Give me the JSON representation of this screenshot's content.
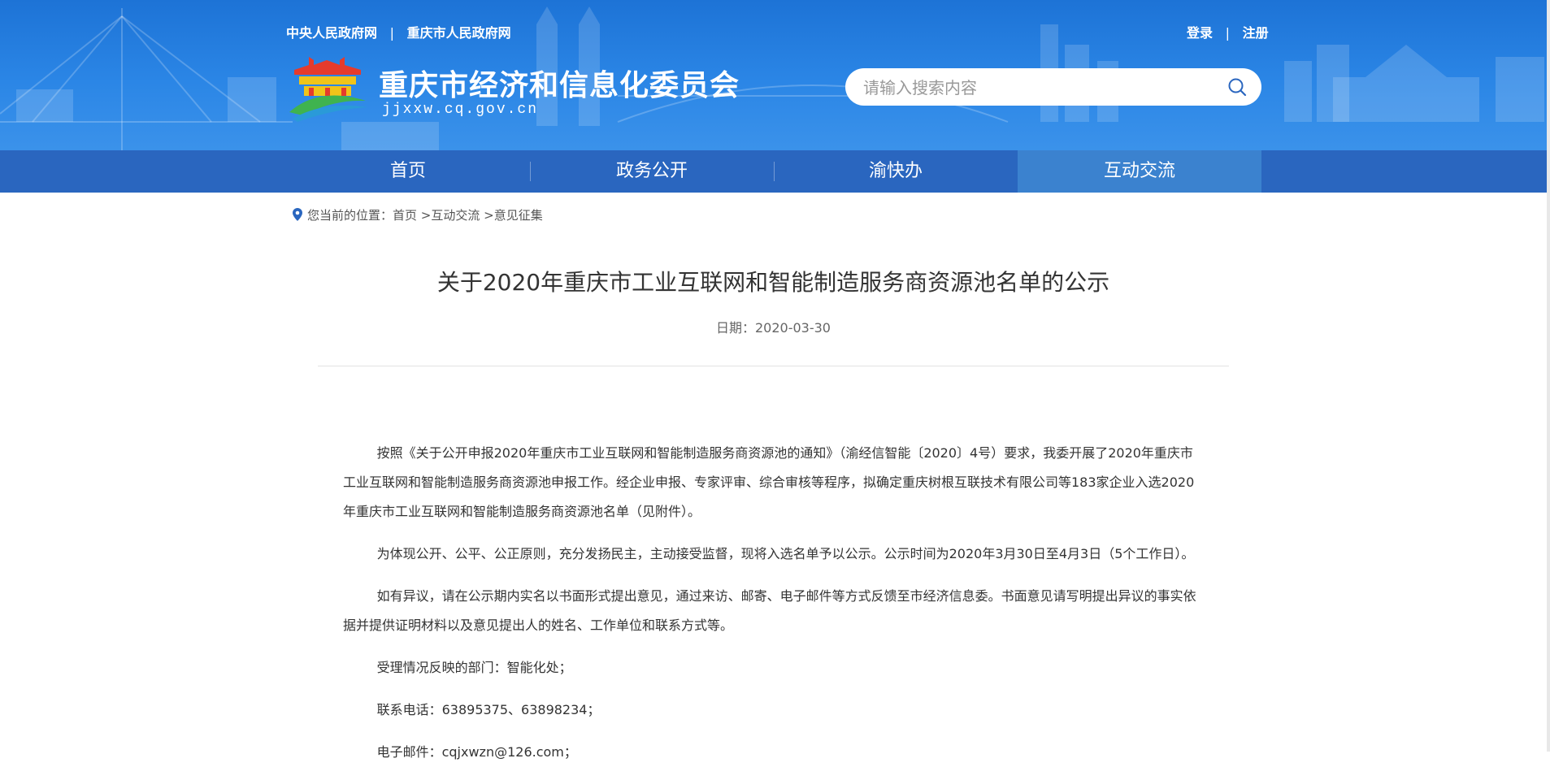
{
  "header": {
    "gov_links": [
      "中央人民政府网",
      "重庆市人民政府网"
    ],
    "user_links": [
      "登录",
      "注册"
    ],
    "site_title": "重庆市经济和信息化委员会",
    "site_domain": "jjxxw.cq.gov.cn",
    "search_placeholder": "请输入搜索内容",
    "search_icon": "search-icon"
  },
  "nav": {
    "items": [
      {
        "label": "首页"
      },
      {
        "label": "政务公开"
      },
      {
        "label": "渝快办"
      },
      {
        "label": "互动交流"
      }
    ],
    "active_index": 3
  },
  "breadcrumb": {
    "prefix": "您当前的位置：",
    "items": [
      "首页",
      "互动交流",
      "意见征集"
    ]
  },
  "article": {
    "title": "关于2020年重庆市工业互联网和智能制造服务商资源池名单的公示",
    "date": "日期：2020-03-30",
    "paragraphs": [
      "按照《关于公开申报2020年重庆市工业互联网和智能制造服务商资源池的通知》（渝经信智能〔2020〕4号）要求，我委开展了2020年重庆市工业互联网和智能制造服务商资源池申报工作。经企业申报、专家评审、综合审核等程序，拟确定重庆树根互联技术有限公司等183家企业入选2020年重庆市工业互联网和智能制造服务商资源池名单（见附件）。",
      "为体现公开、公平、公正原则，充分发扬民主，主动接受监督，现将入选名单予以公示。公示时间为2020年3月30日至4月3日（5个工作日）。",
      "如有异议，请在公示期内实名以书面形式提出意见，通过来访、邮寄、电子邮件等方式反馈至市经济信息委。书面意见请写明提出异议的事实依据并提供证明材料以及意见提出人的姓名、工作单位和联系方式等。",
      "受理情况反映的部门：智能化处；",
      "联系电话：63895375、63898234；",
      "电子邮件：cqjxwzn@126.com；"
    ]
  },
  "colors": {
    "header_blue": "#2b86e6",
    "nav_blue": "#2a66bf",
    "nav_active": "#3b82cf"
  }
}
